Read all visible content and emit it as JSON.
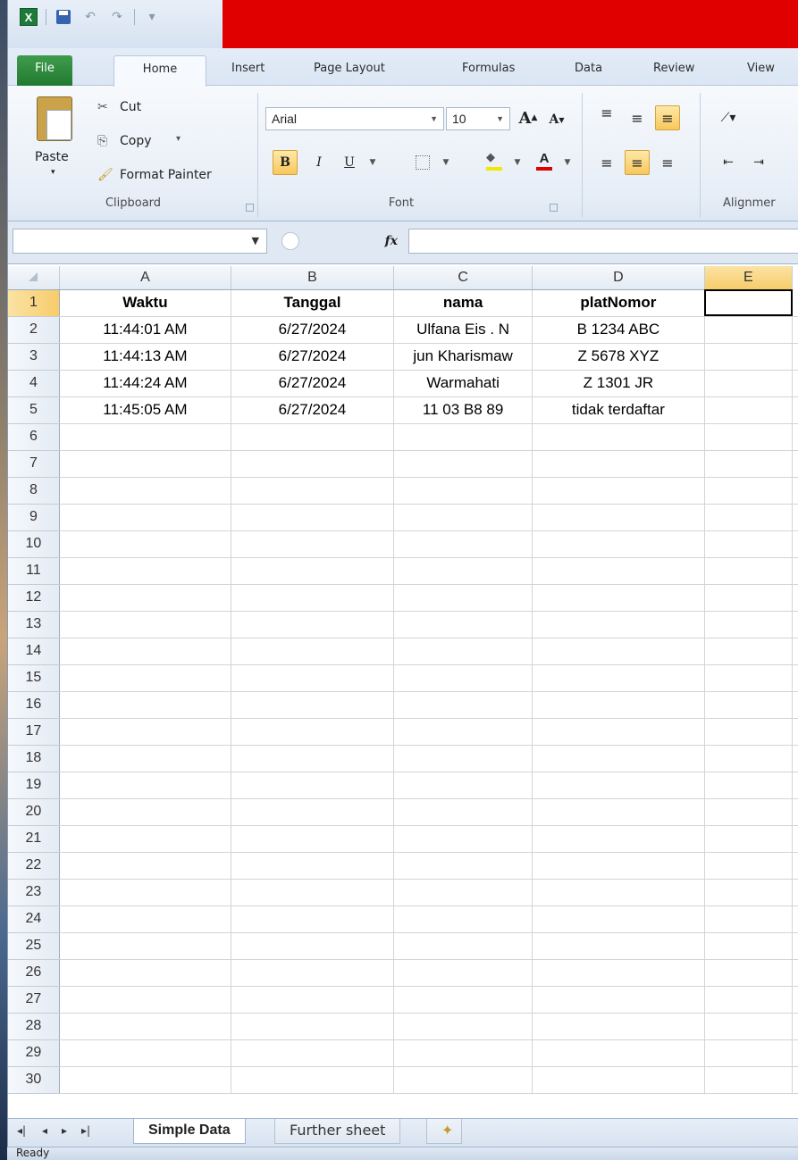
{
  "app": {
    "logo_letter": "X",
    "quick_access": [
      "save-icon",
      "undo-icon",
      "redo-icon",
      "customize-icon"
    ]
  },
  "tabs": [
    "File",
    "Home",
    "Insert",
    "Page Layout",
    "Formulas",
    "Data",
    "Review",
    "View"
  ],
  "ribbon": {
    "clipboard": {
      "label": "Clipboard",
      "paste": "Paste",
      "cut": "Cut",
      "copy": "Copy",
      "copy_arrow": "▾",
      "format_painter": "Format Painter"
    },
    "font": {
      "label": "Font",
      "font_name": "Arial",
      "font_size": "10",
      "grow": "A",
      "shrink": "A",
      "bold": "B",
      "italic": "I",
      "underline": "U"
    },
    "alignment": {
      "label": "Alignmer"
    }
  },
  "formula_bar": {
    "name_box": "",
    "fx": "fx",
    "value": ""
  },
  "sheet": {
    "columns": [
      "A",
      "B",
      "C",
      "D",
      "E"
    ],
    "selected_column": "E",
    "selected_row": "1",
    "header_row": [
      "Waktu",
      "Tanggal",
      "nama",
      "platNomor",
      ""
    ],
    "rows": [
      [
        "11:44:01 AM",
        "6/27/2024",
        "Ulfana Eis . N",
        "B 1234 ABC",
        ""
      ],
      [
        "11:44:13 AM",
        "6/27/2024",
        "jun Kharismaw",
        "Z 5678 XYZ",
        ""
      ],
      [
        "11:44:24 AM",
        "6/27/2024",
        "Warmahati",
        "Z 1301 JR",
        ""
      ],
      [
        "11:45:05 AM",
        "6/27/2024",
        "11 03 B8 89",
        "tidak terdaftar",
        ""
      ]
    ],
    "total_rows": 30
  },
  "sheet_tabs": {
    "active": "Simple Data",
    "other": "Further sheet"
  },
  "status": {
    "text": "Ready"
  }
}
